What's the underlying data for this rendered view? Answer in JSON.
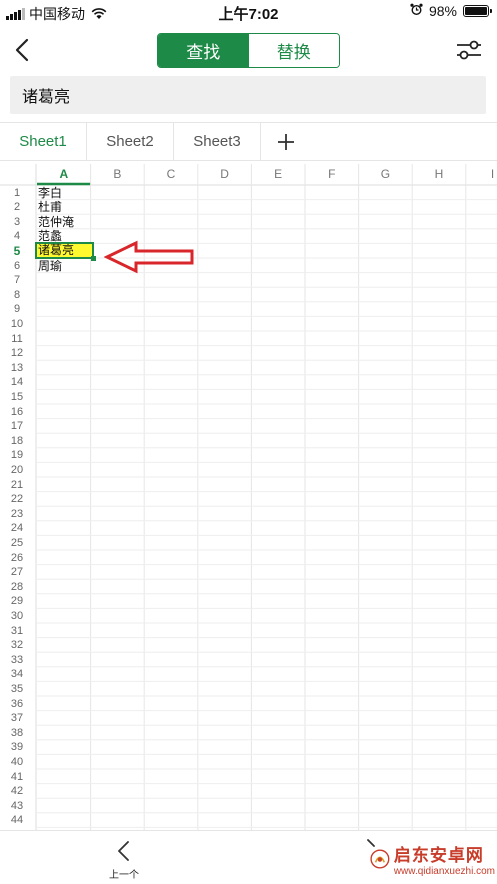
{
  "status_bar": {
    "carrier": "中国移动",
    "time": "上午7:02",
    "battery_text": "98%",
    "battery_level": 0.98
  },
  "header": {
    "segment_find": "查找",
    "segment_replace": "替换",
    "active_segment": "查找"
  },
  "search": {
    "value": "诸葛亮"
  },
  "tabs": [
    {
      "label": "Sheet1",
      "active": true
    },
    {
      "label": "Sheet2",
      "active": false
    },
    {
      "label": "Sheet3",
      "active": false
    }
  ],
  "grid": {
    "columns": [
      "A",
      "B",
      "C",
      "D",
      "E",
      "F",
      "G",
      "H",
      "I"
    ],
    "active_column": "A",
    "row_count": 44,
    "active_row": 5,
    "cells_col_a": [
      "李白",
      "杜甫",
      "范仲淹",
      "范蠡",
      "诸葛亮",
      "周瑜"
    ],
    "selected_cell_text": "诸葛亮"
  },
  "toolbar": {
    "prev_label": "上一个"
  },
  "watermark": {
    "title": "启东安卓网",
    "url": "www.qidianxuezhi.com"
  },
  "colors": {
    "accent": "#1e8a47",
    "highlight": "#fff930",
    "annotation": "#d8262b"
  }
}
